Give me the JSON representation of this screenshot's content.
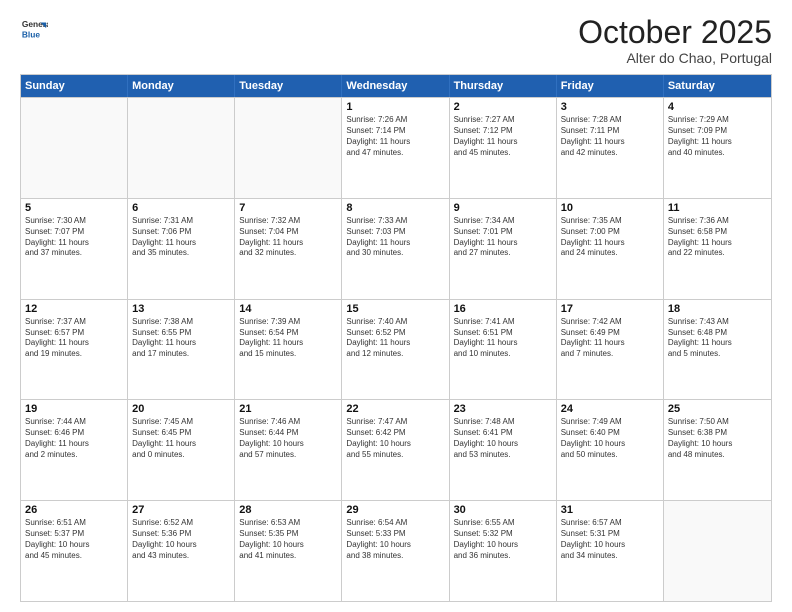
{
  "header": {
    "logo_line1": "General",
    "logo_line2": "Blue",
    "title": "October 2025",
    "subtitle": "Alter do Chao, Portugal"
  },
  "weekdays": [
    "Sunday",
    "Monday",
    "Tuesday",
    "Wednesday",
    "Thursday",
    "Friday",
    "Saturday"
  ],
  "rows": [
    [
      {
        "day": "",
        "info": "",
        "empty": true
      },
      {
        "day": "",
        "info": "",
        "empty": true
      },
      {
        "day": "",
        "info": "",
        "empty": true
      },
      {
        "day": "1",
        "info": "Sunrise: 7:26 AM\nSunset: 7:14 PM\nDaylight: 11 hours\nand 47 minutes."
      },
      {
        "day": "2",
        "info": "Sunrise: 7:27 AM\nSunset: 7:12 PM\nDaylight: 11 hours\nand 45 minutes."
      },
      {
        "day": "3",
        "info": "Sunrise: 7:28 AM\nSunset: 7:11 PM\nDaylight: 11 hours\nand 42 minutes."
      },
      {
        "day": "4",
        "info": "Sunrise: 7:29 AM\nSunset: 7:09 PM\nDaylight: 11 hours\nand 40 minutes."
      }
    ],
    [
      {
        "day": "5",
        "info": "Sunrise: 7:30 AM\nSunset: 7:07 PM\nDaylight: 11 hours\nand 37 minutes."
      },
      {
        "day": "6",
        "info": "Sunrise: 7:31 AM\nSunset: 7:06 PM\nDaylight: 11 hours\nand 35 minutes."
      },
      {
        "day": "7",
        "info": "Sunrise: 7:32 AM\nSunset: 7:04 PM\nDaylight: 11 hours\nand 32 minutes."
      },
      {
        "day": "8",
        "info": "Sunrise: 7:33 AM\nSunset: 7:03 PM\nDaylight: 11 hours\nand 30 minutes."
      },
      {
        "day": "9",
        "info": "Sunrise: 7:34 AM\nSunset: 7:01 PM\nDaylight: 11 hours\nand 27 minutes."
      },
      {
        "day": "10",
        "info": "Sunrise: 7:35 AM\nSunset: 7:00 PM\nDaylight: 11 hours\nand 24 minutes."
      },
      {
        "day": "11",
        "info": "Sunrise: 7:36 AM\nSunset: 6:58 PM\nDaylight: 11 hours\nand 22 minutes."
      }
    ],
    [
      {
        "day": "12",
        "info": "Sunrise: 7:37 AM\nSunset: 6:57 PM\nDaylight: 11 hours\nand 19 minutes."
      },
      {
        "day": "13",
        "info": "Sunrise: 7:38 AM\nSunset: 6:55 PM\nDaylight: 11 hours\nand 17 minutes."
      },
      {
        "day": "14",
        "info": "Sunrise: 7:39 AM\nSunset: 6:54 PM\nDaylight: 11 hours\nand 15 minutes."
      },
      {
        "day": "15",
        "info": "Sunrise: 7:40 AM\nSunset: 6:52 PM\nDaylight: 11 hours\nand 12 minutes."
      },
      {
        "day": "16",
        "info": "Sunrise: 7:41 AM\nSunset: 6:51 PM\nDaylight: 11 hours\nand 10 minutes."
      },
      {
        "day": "17",
        "info": "Sunrise: 7:42 AM\nSunset: 6:49 PM\nDaylight: 11 hours\nand 7 minutes."
      },
      {
        "day": "18",
        "info": "Sunrise: 7:43 AM\nSunset: 6:48 PM\nDaylight: 11 hours\nand 5 minutes."
      }
    ],
    [
      {
        "day": "19",
        "info": "Sunrise: 7:44 AM\nSunset: 6:46 PM\nDaylight: 11 hours\nand 2 minutes."
      },
      {
        "day": "20",
        "info": "Sunrise: 7:45 AM\nSunset: 6:45 PM\nDaylight: 11 hours\nand 0 minutes."
      },
      {
        "day": "21",
        "info": "Sunrise: 7:46 AM\nSunset: 6:44 PM\nDaylight: 10 hours\nand 57 minutes."
      },
      {
        "day": "22",
        "info": "Sunrise: 7:47 AM\nSunset: 6:42 PM\nDaylight: 10 hours\nand 55 minutes."
      },
      {
        "day": "23",
        "info": "Sunrise: 7:48 AM\nSunset: 6:41 PM\nDaylight: 10 hours\nand 53 minutes."
      },
      {
        "day": "24",
        "info": "Sunrise: 7:49 AM\nSunset: 6:40 PM\nDaylight: 10 hours\nand 50 minutes."
      },
      {
        "day": "25",
        "info": "Sunrise: 7:50 AM\nSunset: 6:38 PM\nDaylight: 10 hours\nand 48 minutes."
      }
    ],
    [
      {
        "day": "26",
        "info": "Sunrise: 6:51 AM\nSunset: 5:37 PM\nDaylight: 10 hours\nand 45 minutes."
      },
      {
        "day": "27",
        "info": "Sunrise: 6:52 AM\nSunset: 5:36 PM\nDaylight: 10 hours\nand 43 minutes."
      },
      {
        "day": "28",
        "info": "Sunrise: 6:53 AM\nSunset: 5:35 PM\nDaylight: 10 hours\nand 41 minutes."
      },
      {
        "day": "29",
        "info": "Sunrise: 6:54 AM\nSunset: 5:33 PM\nDaylight: 10 hours\nand 38 minutes."
      },
      {
        "day": "30",
        "info": "Sunrise: 6:55 AM\nSunset: 5:32 PM\nDaylight: 10 hours\nand 36 minutes."
      },
      {
        "day": "31",
        "info": "Sunrise: 6:57 AM\nSunset: 5:31 PM\nDaylight: 10 hours\nand 34 minutes."
      },
      {
        "day": "",
        "info": "",
        "empty": true
      }
    ]
  ]
}
